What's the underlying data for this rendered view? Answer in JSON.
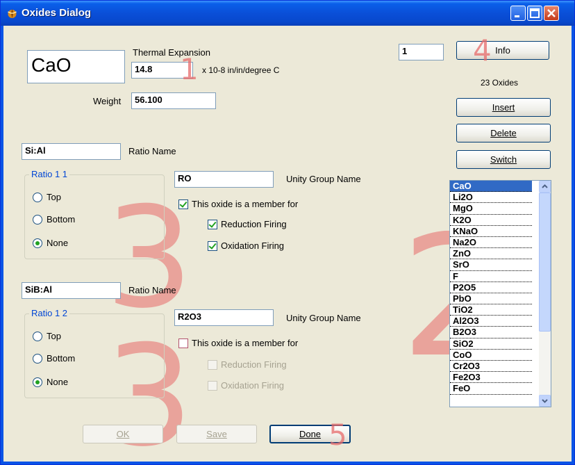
{
  "window": {
    "title": "Oxides Dialog",
    "title_icon": "leaf-icon",
    "accent": "#0a54e6"
  },
  "oxide": {
    "name": "CaO",
    "thermal_label": "Thermal Expansion",
    "thermal_value": "14.8",
    "thermal_unit": "x 10-8 in/in/degree C",
    "weight_label": "Weight",
    "weight_value": "56.100"
  },
  "index_field": "1",
  "buttons": {
    "info": "Info",
    "insert": "Insert",
    "delete": "Delete",
    "switch": "Switch",
    "ok": "OK",
    "save": "Save",
    "done": "Done"
  },
  "oxides_count": "23 Oxides",
  "ratio1": {
    "value": "Si:Al",
    "name_label": "Ratio Name",
    "group_title": "Ratio 1 1",
    "options": [
      "Top",
      "Bottom",
      "None"
    ],
    "selected": "None",
    "unity_value": "RO",
    "unity_label": "Unity Group Name",
    "member_label": "This oxide is a member for",
    "member_checked": true,
    "reduction_label": "Reduction Firing",
    "reduction_checked": true,
    "oxidation_label": "Oxidation Firing",
    "oxidation_checked": true
  },
  "ratio2": {
    "value": "SiB:Al",
    "name_label": "Ratio Name",
    "group_title": "Ratio 1 2",
    "options": [
      "Top",
      "Bottom",
      "None"
    ],
    "selected": "None",
    "unity_value": "R2O3",
    "unity_label": "Unity Group Name",
    "member_label": "This oxide is a member for",
    "member_checked": false,
    "reduction_label": "Reduction Firing",
    "reduction_checked": false,
    "oxidation_label": "Oxidation Firing",
    "oxidation_checked": false
  },
  "oxide_list": [
    "CaO",
    "Li2O",
    "MgO",
    "K2O",
    "KNaO",
    "Na2O",
    "ZnO",
    "SrO",
    "F",
    "P2O5",
    "PbO",
    "TiO2",
    "Al2O3",
    "B2O3",
    "SiO2",
    "CoO",
    "Cr2O3",
    "Fe2O3",
    "FeO"
  ],
  "oxide_list_selected": "CaO",
  "annotations": [
    "1",
    "2",
    "3",
    "4",
    "5"
  ],
  "annotation_color": "#e76b6b"
}
